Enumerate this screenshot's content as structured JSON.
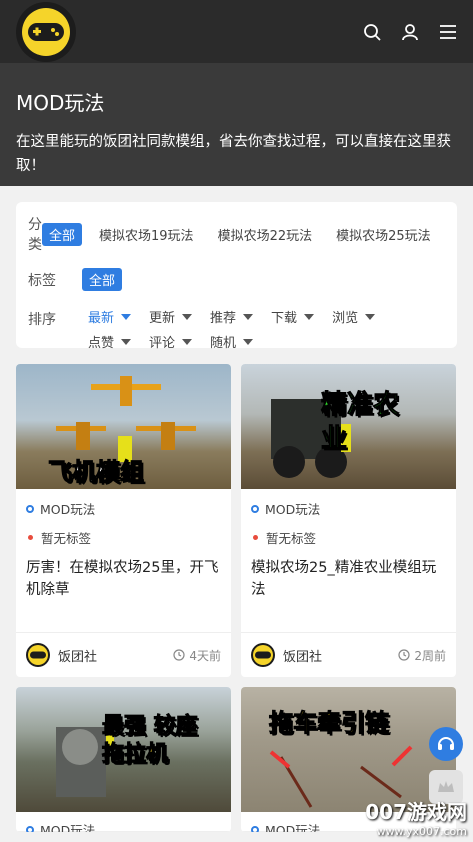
{
  "header": {
    "logo_icon": "gamepad-icon",
    "icons": [
      "search-icon",
      "user-icon",
      "menu-icon"
    ]
  },
  "hero": {
    "title": "MOD玩法",
    "description": "在这里能玩的饭团社同款模组，省去你查找过程，可以直接在这里获取！"
  },
  "filter": {
    "category_label": "分类",
    "categories": [
      "全部",
      "模拟农场19玩法",
      "模拟农场22玩法",
      "模拟农场25玩法"
    ],
    "tag_label": "标签",
    "tags": [
      "全部"
    ],
    "sort_label": "排序",
    "sorts": [
      "最新",
      "更新",
      "推荐",
      "下载",
      "浏览",
      "点赞",
      "评论",
      "随机"
    ]
  },
  "cards": [
    {
      "image_text": "飞机模组",
      "category": "MOD玩法",
      "tag": "暂无标签",
      "title": "厉害！在模拟农场25里，开飞机除草",
      "author": "饭团社",
      "time": "4天前"
    },
    {
      "image_text": "精准农业",
      "category": "MOD玩法",
      "tag": "暂无标签",
      "title": "模拟农场25_精准农业模组玩法",
      "author": "饭团社",
      "time": "2周前"
    },
    {
      "image_text": "最强 较座 拖拉机",
      "category": "MOD玩法"
    },
    {
      "image_text": "拖车牵引链",
      "category": "MOD玩法"
    }
  ],
  "watermark": {
    "line1": "007游戏网",
    "line2": "www.yx007.com"
  },
  "colors": {
    "accent": "#2f7de1",
    "header_bg": "#2b2b2b",
    "hero_bg": "#3a3a3a",
    "logo_yellow": "#f5d42a"
  }
}
